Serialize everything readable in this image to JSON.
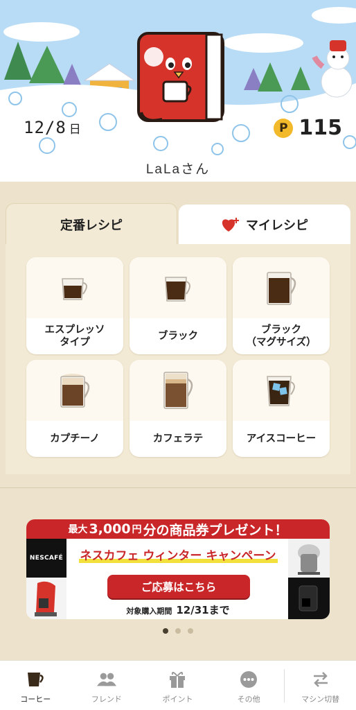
{
  "header": {
    "date": "12/8",
    "date_suffix": "日",
    "points_badge": "P",
    "points_value": "115",
    "username": "LaLaさん"
  },
  "tabs": [
    {
      "label": "定番レシピ",
      "active": true
    },
    {
      "label": "マイレシピ",
      "active": false,
      "icon": "heart-plus-icon"
    }
  ],
  "recipes": [
    {
      "label": "エスプレッソ\nタイプ",
      "icon": "espresso-cup-icon"
    },
    {
      "label": "ブラック",
      "icon": "black-coffee-cup-icon"
    },
    {
      "label": "ブラック\n（マグサイズ）",
      "icon": "mug-icon"
    },
    {
      "label": "カプチーノ",
      "icon": "cappuccino-cup-icon"
    },
    {
      "label": "カフェラテ",
      "icon": "cafe-latte-glass-icon"
    },
    {
      "label": "アイスコーヒー",
      "icon": "iced-coffee-glass-icon"
    }
  ],
  "banner": {
    "ribbon_prefix": "最大",
    "ribbon_amount": "3,000",
    "ribbon_unit": "円",
    "ribbon_suffix": "分の商品券プレゼント！",
    "logo": "NESCAFÉ",
    "title": "ネスカフェ ウィンター キャンペーン",
    "cta": "ご応募はこちら",
    "period_label": "対象購入期間",
    "period_date": "12/31まで"
  },
  "carousel": {
    "count": 3,
    "active": 0
  },
  "bottom_nav": [
    {
      "label": "コーヒー",
      "icon": "coffee-cup-icon",
      "active": true
    },
    {
      "label": "フレンド",
      "icon": "friends-icon",
      "active": false
    },
    {
      "label": "ポイント",
      "icon": "gift-icon",
      "active": false
    },
    {
      "label": "その他",
      "icon": "more-icon",
      "active": false
    },
    {
      "label": "マシン切替",
      "icon": "swap-icon",
      "active": false
    }
  ],
  "colors": {
    "accent_red": "#c9262a",
    "background": "#ede3cc",
    "sky": "#b8dcf5",
    "points_gold": "#f2b92a"
  }
}
